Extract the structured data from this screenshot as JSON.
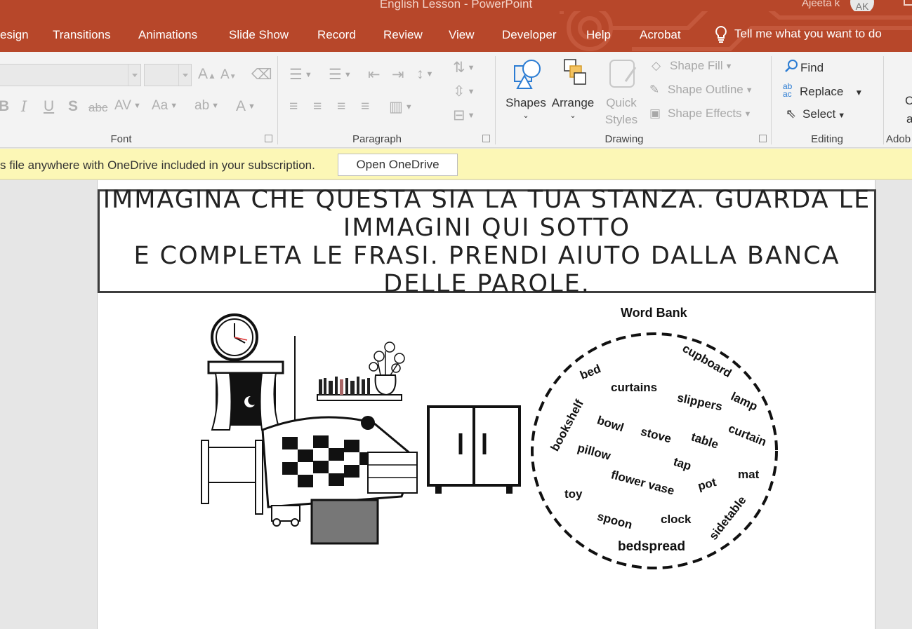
{
  "window": {
    "title": "English Lesson  -  PowerPoint",
    "user": "Ajeeta k",
    "avatar": "AK"
  },
  "tabs": [
    {
      "label": "esign"
    },
    {
      "label": "Transitions"
    },
    {
      "label": "Animations"
    },
    {
      "label": "Slide Show"
    },
    {
      "label": "Record"
    },
    {
      "label": "Review"
    },
    {
      "label": "View"
    },
    {
      "label": "Developer"
    },
    {
      "label": "Help"
    },
    {
      "label": "Acrobat"
    }
  ],
  "tellme": "Tell me what you want to do",
  "ribbon": {
    "font": {
      "label": "Font",
      "grow_font": "A",
      "shrink_font": "A",
      "bold": "B",
      "italic": "I",
      "underline": "U",
      "shadow": "S",
      "strikethrough": "abc",
      "char_spacing": "AV",
      "change_case": "Aa",
      "font_color": "A"
    },
    "paragraph": {
      "label": "Paragraph"
    },
    "drawing": {
      "label": "Drawing",
      "shapes": "Shapes",
      "arrange": "Arrange",
      "quick_styles_1": "Quick",
      "quick_styles_2": "Styles",
      "shape_fill": "Shape Fill",
      "shape_outline": "Shape Outline",
      "shape_effects": "Shape Effects"
    },
    "editing": {
      "label": "Editing",
      "find": "Find",
      "replace": "Replace",
      "select": "Select"
    },
    "adobe": {
      "label": "Adob",
      "partial_1": "C",
      "partial_2": "a"
    }
  },
  "notification": {
    "message": "s file anywhere with OneDrive included in your subscription.",
    "button": "Open OneDrive"
  },
  "slide": {
    "title_line1": "IMMAGINA CHE QUESTA SIA LA TUA STANZA. GUARDA LE",
    "title_line2": "IMMAGINI QUI SOTTO",
    "title_line3": "E COMPLETA LE FRASI. PRENDI AIUTO DALLA BANCA",
    "title_line4": "DELLE PAROLE.",
    "word_bank_title": "Word Bank",
    "words": {
      "cupboard": "cupboard",
      "bed": "bed",
      "curtains": "curtains",
      "slippers": "slippers",
      "lamp": "lamp",
      "bookshelf": "bookshelf",
      "bowl": "bowl",
      "stove": "stove",
      "table": "table",
      "curtain": "curtain",
      "pillow": "pillow",
      "tap": "tap",
      "flower_vase": "flower vase",
      "pot": "pot",
      "mat": "mat",
      "toy": "toy",
      "spoon": "spoon",
      "clock": "clock",
      "sidetable": "sidetable",
      "bedspread": "bedspread"
    }
  }
}
